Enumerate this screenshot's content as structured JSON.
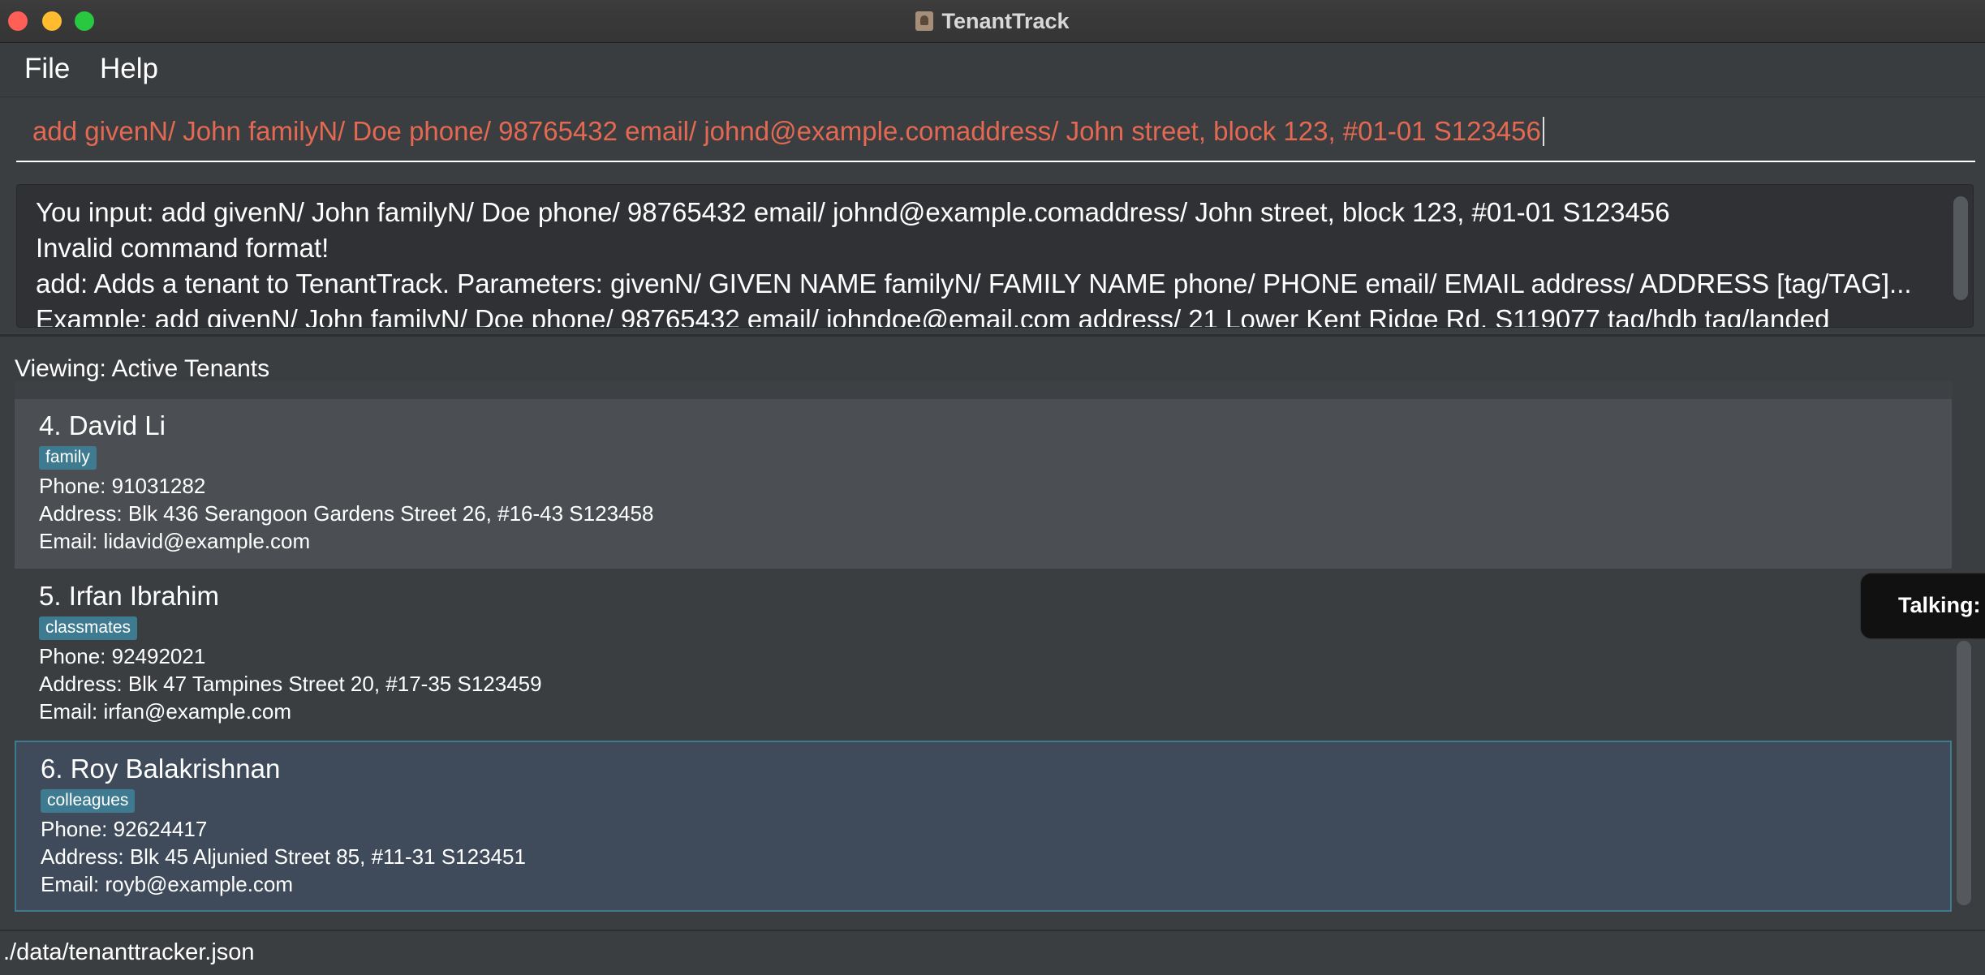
{
  "window": {
    "title": "TenantTrack",
    "app_icon": "tenanttrack-app-icon"
  },
  "menu": {
    "file": "File",
    "help": "Help"
  },
  "command": {
    "value": "add givenN/ John familyN/ Doe phone/ 98765432 email/ johnd@example.comaddress/ John street, block 123, #01-01 S123456",
    "text_color": "#e36952"
  },
  "result": {
    "lines": [
      "You input: add givenN/ John familyN/ Doe phone/ 98765432 email/ johnd@example.comaddress/ John street, block 123, #01-01 S123456",
      "Invalid command format!",
      "add: Adds a tenant to TenantTrack. Parameters: givenN/ GIVEN NAME familyN/ FAMILY NAME phone/ PHONE email/ EMAIL address/ ADDRESS [tag/TAG]...",
      "Example: add givenN/ John familyN/ Doe phone/ 98765432 email/ johndoe@email.com address/ 21 Lower Kent Ridge Rd, S119077 tag/hdb tag/landed"
    ]
  },
  "list": {
    "viewing_label": "Viewing: Active Tenants",
    "tenants": [
      {
        "name": "4. David Li",
        "tag": "family",
        "phone": "Phone: 91031282",
        "address": "Address: Blk 436 Serangoon Gardens Street 26, #16-43 S123458",
        "email": "Email: lidavid@example.com"
      },
      {
        "name": "5. Irfan Ibrahim",
        "tag": "classmates",
        "phone": "Phone: 92492021",
        "address": "Address: Blk 47 Tampines Street 20, #17-35 S123459",
        "email": "Email: irfan@example.com"
      },
      {
        "name": "6. Roy Balakrishnan",
        "tag": "colleagues",
        "phone": "Phone: 92624417",
        "address": "Address: Blk 45 Aljunied Street 85, #11-31 S123451",
        "email": "Email: royb@example.com"
      }
    ]
  },
  "tooltip": {
    "text": "Talking:"
  },
  "status": {
    "path": "./data/tenanttracker.json"
  },
  "colors": {
    "tag_bg": "#3e7b91",
    "selected_card_bg": "#3f4b5b",
    "background": "#3b3e41"
  }
}
